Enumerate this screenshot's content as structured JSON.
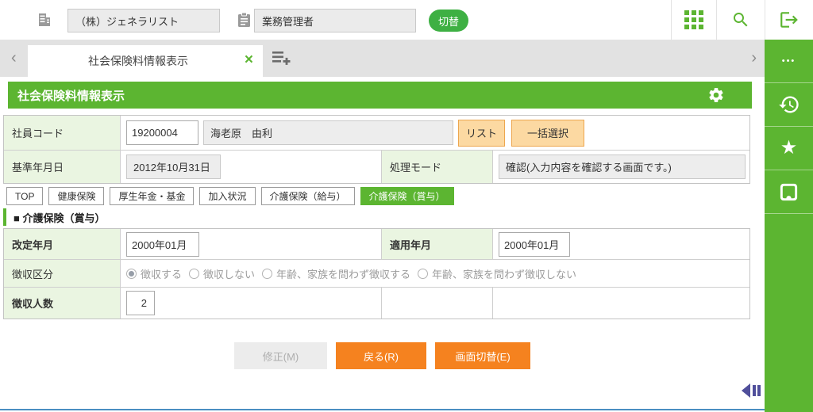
{
  "colors": {
    "green": "#5cb531",
    "switch_green": "#3eb043",
    "orange": "#f5821f",
    "peach_bg": "#fcd9a2",
    "peach_border": "#eda74f",
    "label_bg": "#eaf5e1",
    "purple_arrow": "#504f9b",
    "bottom_line_blue": "#4a8fc2"
  },
  "header": {
    "company_value": "（株）ジェネラリスト",
    "role_value": "業務管理者",
    "switch_label": "切替"
  },
  "tabbar": {
    "scroll_left_glyph": "‹",
    "scroll_right_glyph": "›",
    "active_tab_label": "社会保険料情報表示",
    "close_glyph": "×"
  },
  "sidebar": {
    "ellipsis_glyph": "•••",
    "star_glyph": "★"
  },
  "titlebar": {
    "title": "社会保険料情報表示"
  },
  "form": {
    "employee_code_label": "社員コード",
    "employee_code": "19200004",
    "employee_name": "海老原　由利",
    "list_button": "リスト",
    "bulk_select_button": "一括選択",
    "base_date_label": "基準年月日",
    "base_date": "2012年10月31日",
    "mode_label": "処理モード",
    "mode_value": "確認(入力内容を確認する画面です。)"
  },
  "subtabs": [
    {
      "label": "TOP",
      "active": false
    },
    {
      "label": "健康保険",
      "active": false
    },
    {
      "label": "厚生年金・基金",
      "active": false
    },
    {
      "label": "加入状況",
      "active": false
    },
    {
      "label": "介護保険（給与）",
      "active": false
    },
    {
      "label": "介護保険（賞与）",
      "active": true
    }
  ],
  "section": {
    "heading": "■ 介護保険（賞与）",
    "revision_label": "改定年月",
    "revision_value": "2000年01月",
    "apply_label": "適用年月",
    "apply_value": "2000年01月",
    "collect_label": "徴収区分",
    "collect_options": [
      {
        "label": "徴収する",
        "selected": true
      },
      {
        "label": "徴収しない",
        "selected": false
      },
      {
        "label": "年齢、家族を問わず徴収する",
        "selected": false
      },
      {
        "label": "年齢、家族を問わず徴収しない",
        "selected": false
      }
    ],
    "count_label": "徴収人数",
    "count_value": "2"
  },
  "footer": {
    "buttons": [
      {
        "label": "修正(M)",
        "disabled": true
      },
      {
        "label": "戻る(R)",
        "disabled": false
      },
      {
        "label": "画面切替(E)",
        "disabled": false
      }
    ]
  }
}
